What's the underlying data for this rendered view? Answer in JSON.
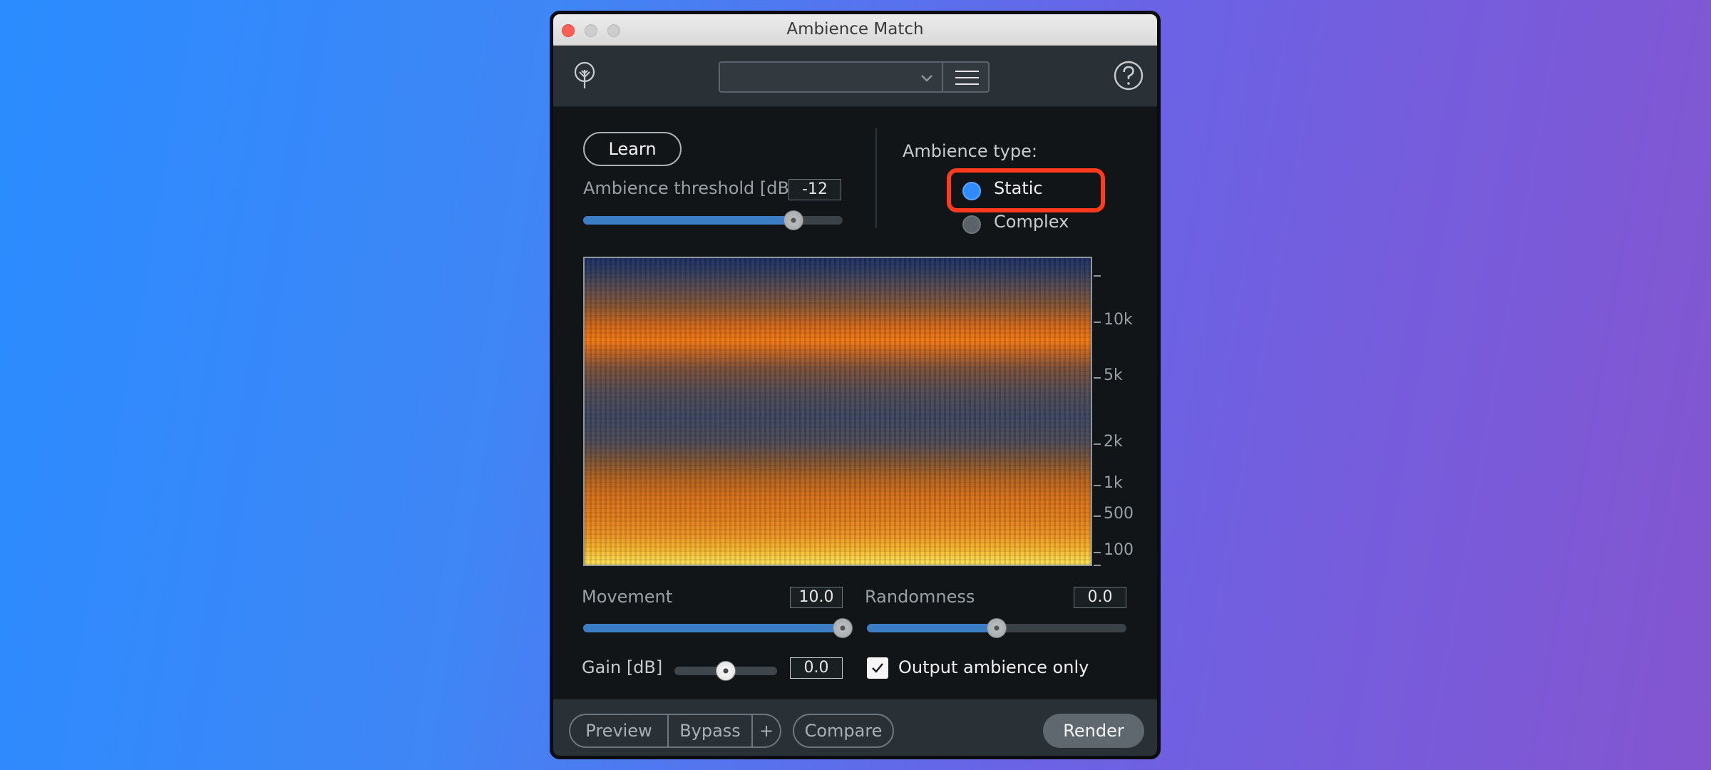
{
  "window": {
    "title": "Ambience Match"
  },
  "toolbar": {
    "preset_value": "",
    "logo_icon": "ozone-logo-icon",
    "menu_icon": "hamburger-icon",
    "help_icon": "question-icon"
  },
  "learn": {
    "label": "Learn"
  },
  "threshold": {
    "label": "Ambience threshold [dB]",
    "value": "-12",
    "level": 0.81
  },
  "ambience_type": {
    "label": "Ambience type:",
    "options": [
      {
        "label": "Static",
        "selected": true
      },
      {
        "label": "Complex",
        "selected": false
      }
    ]
  },
  "spectrogram": {
    "freq_labels": [
      "10k",
      "5k",
      "2k",
      "1k",
      "500",
      "100"
    ]
  },
  "movement": {
    "label": "Movement",
    "value": "10.0",
    "level": 1.0
  },
  "randomness": {
    "label": "Randomness",
    "value": "0.0",
    "level": 0.5
  },
  "gain": {
    "label": "Gain [dB]",
    "value": "0.0",
    "level": 0.5
  },
  "output_ambience": {
    "label": "Output ambience only",
    "checked": true
  },
  "footer": {
    "preview": "Preview",
    "bypass": "Bypass",
    "plus": "+",
    "compare": "Compare",
    "render": "Render"
  },
  "colors": {
    "accent": "#2f8cff",
    "slider_fill": "#3b7ec5",
    "highlight": "#ff3b1f"
  }
}
